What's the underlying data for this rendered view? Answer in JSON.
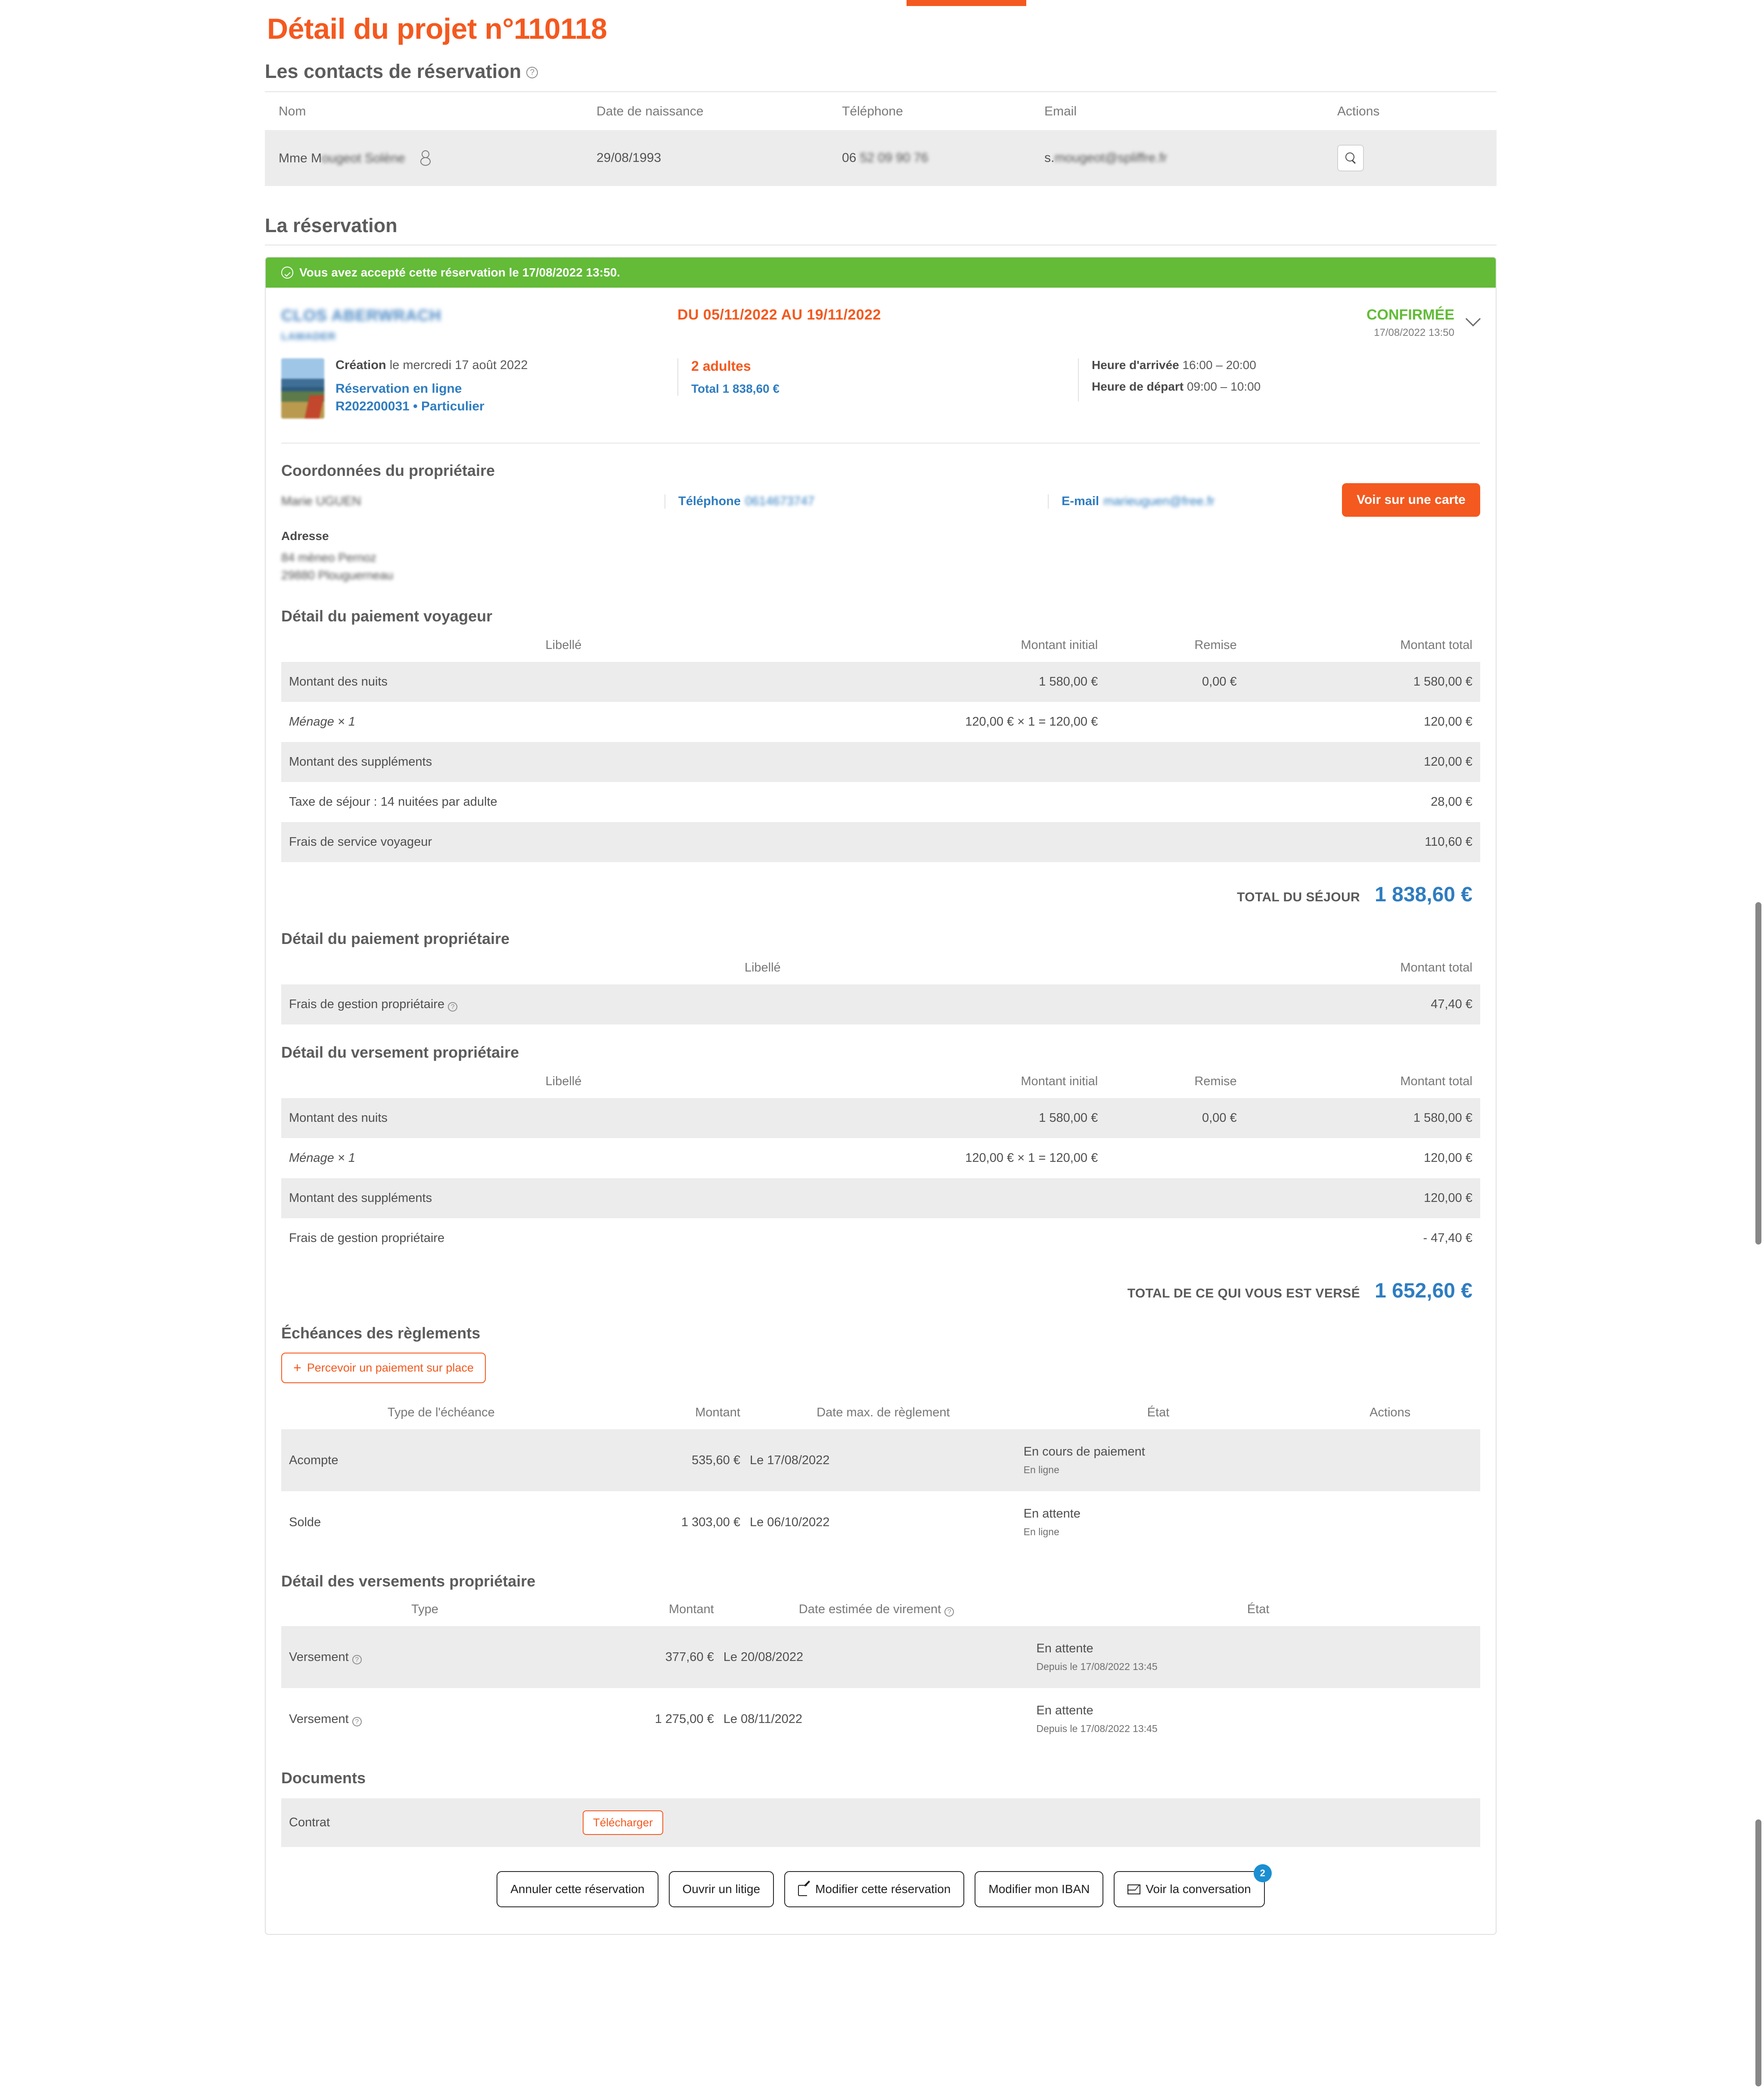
{
  "page": {
    "title": "Détail du projet n°110118"
  },
  "contacts": {
    "heading": "Les contacts de réservation",
    "columns": [
      "Nom",
      "Date de naissance",
      "Téléphone",
      "Email",
      "Actions"
    ],
    "rows": [
      {
        "nom_prefix": "Mme M",
        "nom_redacted": "ougeot Solène",
        "dob": "29/08/1993",
        "tel_prefix": "06",
        "tel_redacted": "52 09 90 76",
        "email_prefix": "s.",
        "email_redacted": "mougeot@spliffre.fr",
        "action_icon": "search-icon"
      }
    ]
  },
  "reservation": {
    "heading": "La réservation",
    "banner": "Vous avez accepté cette réservation le 17/08/2022 13:50.",
    "property_name": "CLOS ABERWRACH",
    "property_sub": "LAMADER",
    "stay_dates": "DU 05/11/2022 AU 19/11/2022",
    "status": "CONFIRMÉE",
    "status_date": "17/08/2022 13:50",
    "creation_label": "Création",
    "creation_value": "le mercredi 17 août 2022",
    "link_line1": "Réservation en ligne",
    "link_line2": "R202200031 • Particulier",
    "guests": "2 adultes",
    "total_label": "Total",
    "total_value": "1 838,60 €",
    "arrival_label": "Heure d'arrivée",
    "arrival_value": "16:00 – 20:00",
    "departure_label": "Heure de départ",
    "departure_value": "09:00 – 10:00"
  },
  "owner": {
    "heading": "Coordonnées du propriétaire",
    "name": "Marie UGUEN",
    "phone_label": "Téléphone",
    "phone_value": "0614673747",
    "email_label": "E-mail",
    "email_value": "marieuguen@free.fr",
    "address_label": "Adresse",
    "address_line1": "84 mèneo Pernoz",
    "address_line2": "29880 Plouguerneau",
    "map_button": "Voir sur une carte"
  },
  "traveler_payment": {
    "heading": "Détail du paiement voyageur",
    "columns": [
      "Libellé",
      "Montant initial",
      "Remise",
      "Montant total"
    ],
    "rows": [
      {
        "label": "Montant des nuits",
        "italic": false,
        "initial": "1 580,00 €",
        "remise": "0,00 €",
        "total": "1 580,00 €"
      },
      {
        "label": "Ménage × 1",
        "italic": true,
        "initial": "120,00 € × 1 = 120,00 €",
        "remise": "",
        "total": "120,00 €"
      },
      {
        "label": "Montant des suppléments",
        "italic": false,
        "initial": "",
        "remise": "",
        "total": "120,00 €"
      },
      {
        "label": "Taxe de séjour : 14 nuitées par adulte",
        "italic": false,
        "initial": "",
        "remise": "",
        "total": "28,00 €"
      },
      {
        "label": "Frais de service voyageur",
        "italic": false,
        "initial": "",
        "remise": "",
        "total": "110,60 €"
      }
    ],
    "total_label": "TOTAL DU SÉJOUR",
    "total_value": "1 838,60 €"
  },
  "owner_payment": {
    "heading": "Détail du paiement propriétaire",
    "columns": [
      "Libellé",
      "Montant total"
    ],
    "rows": [
      {
        "label": "Frais de gestion propriétaire",
        "has_help": true,
        "total": "47,40 €"
      }
    ]
  },
  "owner_remittance": {
    "heading": "Détail du versement propriétaire",
    "columns": [
      "Libellé",
      "Montant initial",
      "Remise",
      "Montant total"
    ],
    "rows": [
      {
        "label": "Montant des nuits",
        "italic": false,
        "initial": "1 580,00 €",
        "remise": "0,00 €",
        "total": "1 580,00 €",
        "negative": false
      },
      {
        "label": "Ménage × 1",
        "italic": true,
        "initial": "120,00 € × 1 = 120,00 €",
        "remise": "",
        "total": "120,00 €",
        "negative": false
      },
      {
        "label": "Montant des suppléments",
        "italic": false,
        "initial": "",
        "remise": "",
        "total": "120,00 €",
        "negative": false
      },
      {
        "label": "Frais de gestion propriétaire",
        "italic": false,
        "initial": "",
        "remise": "",
        "total": "- 47,40 €",
        "negative": true
      }
    ],
    "total_label": "TOTAL DE CE QUI VOUS EST VERSÉ",
    "total_value": "1 652,60 €"
  },
  "installments": {
    "heading": "Échéances des règlements",
    "add_button": "Percevoir un paiement sur place",
    "columns": [
      "Type de l'échéance",
      "Montant",
      "Date max. de règlement",
      "État",
      "Actions"
    ],
    "rows": [
      {
        "type": "Acompte",
        "amount": "535,60 €",
        "date": "Le 17/08/2022",
        "state": "En cours de paiement",
        "state_sub": "En ligne"
      },
      {
        "type": "Solde",
        "amount": "1 303,00 €",
        "date": "Le 06/10/2022",
        "state": "En attente",
        "state_sub": "En ligne"
      }
    ]
  },
  "remittances": {
    "heading": "Détail des versements propriétaire",
    "columns": [
      "Type",
      "Montant",
      "Date estimée de virement",
      "État"
    ],
    "rows": [
      {
        "type": "Versement",
        "amount": "377,60 €",
        "date": "Le 20/08/2022",
        "state": "En attente",
        "state_sub": "Depuis le 17/08/2022 13:45"
      },
      {
        "type": "Versement",
        "amount": "1 275,00 €",
        "date": "Le 08/11/2022",
        "state": "En attente",
        "state_sub": "Depuis le 17/08/2022 13:45"
      }
    ]
  },
  "documents": {
    "heading": "Documents",
    "rows": [
      {
        "name": "Contrat",
        "action": "Télécharger"
      }
    ]
  },
  "footer_actions": {
    "cancel": "Annuler cette réservation",
    "dispute": "Ouvrir un litige",
    "modify": "Modifier cette réservation",
    "iban": "Modifier mon IBAN",
    "conversation": "Voir la conversation",
    "conversation_badge": "2"
  },
  "colors": {
    "accent_orange": "#f4591f",
    "link_blue": "#2f7dc0",
    "success_green": "#63bb38",
    "negative_red": "#d0342c",
    "badge_blue": "#1b8fd1"
  }
}
